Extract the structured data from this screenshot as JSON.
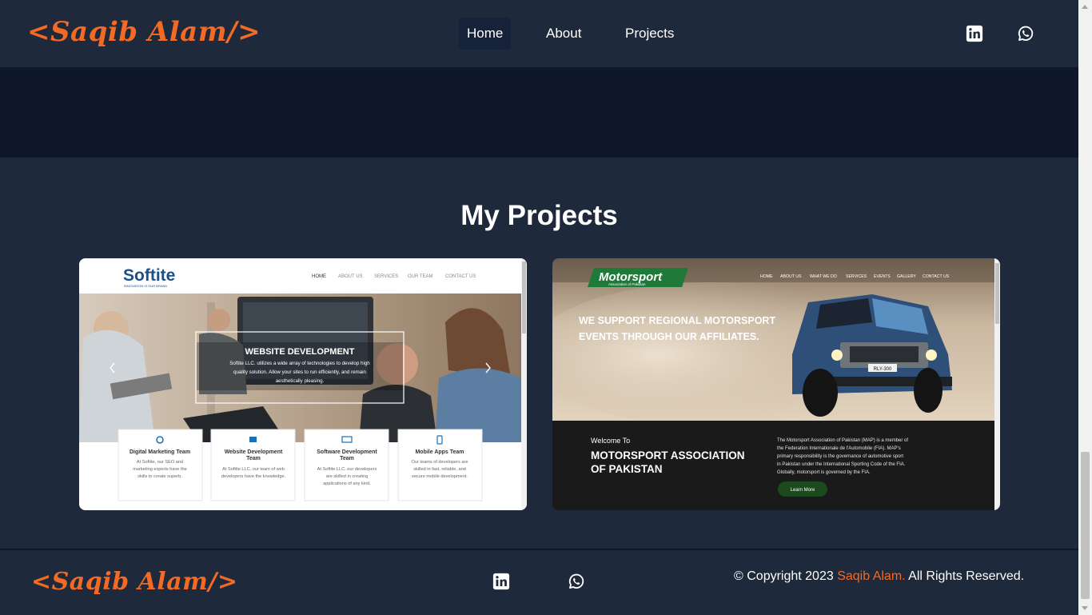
{
  "nav": {
    "logo": "<Saqib Alam/>",
    "links": [
      "Home",
      "About",
      "Projects"
    ],
    "social": [
      "linkedin-icon",
      "whatsapp-icon"
    ]
  },
  "projects": {
    "title": "My Projects",
    "softite": {
      "brand": "Softite",
      "tagline": "INNOVATION IS OUR BRAND",
      "menu": [
        "HOME",
        "ABOUT US",
        "SERVICES",
        "OUR TEAM",
        "CONTACT US"
      ],
      "hero_heading": "WEBSITE DEVELOPMENT",
      "hero_text_1": "Softite LLC. utilizes a wide array of technologies to develop high",
      "hero_text_2": "quality solution. Allow your sites to run efficiently, and remain",
      "hero_text_3": "aesthetically pleasing.",
      "services": [
        {
          "title": "Digital Marketing Team",
          "l1": "At Softite, our SEO and",
          "l2": "marketing experts have the",
          "l3": "skills to create superb."
        },
        {
          "title": "Website Development",
          "title2": "Team",
          "l1": "At Softite LLC. our team of web",
          "l2": "developers have the knowledge.",
          "l3": ""
        },
        {
          "title": "Software Development",
          "title2": "Team",
          "l1": "At Softite LLC. our developers",
          "l2": "are skilled in creating",
          "l3": "applications of any kind."
        },
        {
          "title": "Mobile Apps Team",
          "l1": "Our teams of developers are",
          "l2": "skilled in fast, reliable, and",
          "l3": "secure mobile development."
        }
      ]
    },
    "motorsport": {
      "brand": "Motorsport",
      "brand_sub": "Association of Pakistan",
      "menu": [
        "HOME",
        "ABOUT US",
        "WHAT WE DO",
        "SERVICES",
        "EVENTS",
        "GALLERY",
        "CONTACT US"
      ],
      "hero_line_1": "WE SUPPORT REGIONAL MOTORSPORT",
      "hero_line_2": "EVENTS THROUGH OUR AFFILIATES.",
      "welcome": "Welcome To",
      "org_1": "MOTORSPORT ASSOCIATION",
      "org_2": "OF PAKISTAN",
      "desc_1": "The Motorsport Association of Pakistan (MAP) is a member of",
      "desc_2": "the Federation Internationale de l'Automobile (FIA). MAP's",
      "desc_3": "primary responsibility is the governance of automotive sport",
      "desc_4": "in Pakistan under the International Sporting Code of the FIA.",
      "desc_5": "Globally, motorsport is governed by the FIA.",
      "cta": "Learn More",
      "plate": "RLY-300"
    }
  },
  "footer": {
    "logo": "<Saqib Alam/>",
    "copyright_prefix": "© Copyright 2023 ",
    "copyright_name": "Saqib Alam.",
    "copyright_suffix": " All Rights Reserved."
  },
  "colors": {
    "accent": "#f26a24",
    "navy": "#1e293b",
    "dark_navy": "#0f172a"
  }
}
